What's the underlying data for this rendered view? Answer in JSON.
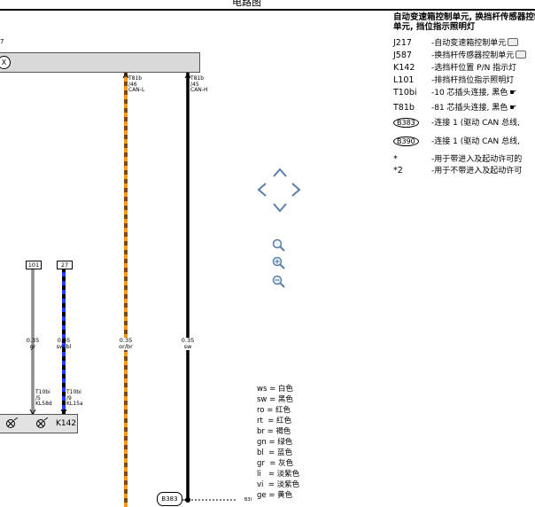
{
  "page": {
    "title": "电路图",
    "top_left_code": "7"
  },
  "controller": {
    "symbol": "X"
  },
  "wires": [
    {
      "id": "can-l",
      "pin_label": "T81b\n/46\nCAN-L",
      "spec": "0.35\nor/br"
    },
    {
      "id": "can-h",
      "pin_label": "T81b\n/45\nCAN-H",
      "spec": "0.35\nsw"
    },
    {
      "id": "w101",
      "box": "101",
      "spec": "0.35\ngr",
      "pin_label": "T10bi\n/5\nKL58d"
    },
    {
      "id": "w27",
      "box": "27",
      "spec": "0.35\nsw/bl",
      "pin_label": "T10bi\n/9\nKL15a"
    }
  ],
  "component": {
    "label": "K142"
  },
  "ground": {
    "label": "B383",
    "side_label": "B3I"
  },
  "legend": {
    "title": "自动变速箱控制单元, 换挡杆传感器控制单元, 挡位指示照明灯",
    "items": [
      {
        "code": "J217",
        "desc": "-自动变速箱控制单元",
        "icon": "camera-icon"
      },
      {
        "code": "J587",
        "desc": "-换挡杆传感器控制单元",
        "icon": "camera-icon"
      },
      {
        "code": "K142",
        "desc": "-选挡杆位置 P/N 指示灯"
      },
      {
        "code": "L101",
        "desc": "-排挡杆挡位指示照明灯"
      },
      {
        "code": "T10bi",
        "desc": "-10 芯插头连接, 黑色",
        "icon": "hand-icon"
      },
      {
        "code": "T81b",
        "desc": "-81 芯插头连接, 黑色",
        "icon": "hand-icon"
      },
      {
        "code": "B383",
        "desc": "-连接 1 (驱动 CAN 总线,",
        "circled": true
      },
      {
        "code": "B390",
        "desc": "-连接 1 (驱动 CAN 总线,",
        "circled": true
      },
      {
        "code": "*",
        "desc": "-用于带进入及起动许可的"
      },
      {
        "code": "*2",
        "desc": "-用于不带进入及起动许可"
      }
    ]
  },
  "colors_legend": [
    "ws = 白色",
    "sw = 黑色",
    "ro = 红色",
    "rt  = 红色",
    "br = 褐色",
    "gn = 绿色",
    "bl  = 蓝色",
    "gr  = 灰色",
    "li   = 淡紫色",
    "vi  = 淡紫色",
    "ge = 黄色"
  ],
  "nav": {
    "up": "up-arrow",
    "left": "left-arrow",
    "right": "right-arrow",
    "down": "down-arrow"
  },
  "zoom": [
    "zoom-fit",
    "zoom-in",
    "zoom-out"
  ],
  "wire_colors": {
    "orange": "#f29a1d",
    "brown": "#7a4a22",
    "black": "#000000",
    "gray": "#8c8c8c",
    "blue": "#1f3cff"
  }
}
